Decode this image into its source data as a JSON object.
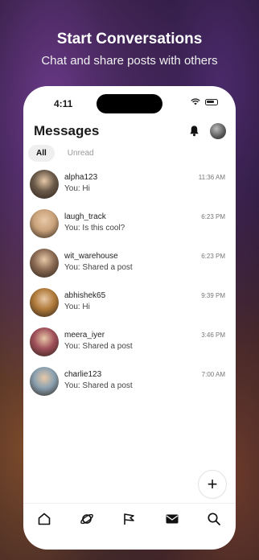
{
  "hero": {
    "title": "Start Conversations",
    "subtitle": "Chat and share posts with others"
  },
  "status_bar": {
    "time": "4:11"
  },
  "header": {
    "title": "Messages"
  },
  "filters": [
    {
      "label": "All",
      "active": true
    },
    {
      "label": "Unread",
      "active": false
    }
  ],
  "conversations": [
    {
      "name": "alpha123",
      "preview": "You: Hi",
      "time": "11:36 AM",
      "avatar_color": "#6b5a4a"
    },
    {
      "name": "laugh_track",
      "preview": "You: Is this cool?",
      "time": "6:23 PM",
      "avatar_color": "#c9a27a"
    },
    {
      "name": "wit_warehouse",
      "preview": "You: Shared a post",
      "time": "6:23 PM",
      "avatar_color": "#8a6a52"
    },
    {
      "name": "abhishek65",
      "preview": "You: Hi",
      "time": "9:39 PM",
      "avatar_color": "#b07a3a"
    },
    {
      "name": "meera_iyer",
      "preview": "You: Shared a post",
      "time": "3:46 PM",
      "avatar_color": "#a0505a"
    },
    {
      "name": "charlie123",
      "preview": "You: Shared a post",
      "time": "7:00 AM",
      "avatar_color": "#8aa0b0"
    }
  ],
  "fab": {
    "label": "+"
  },
  "tabbar": [
    {
      "icon": "home-icon"
    },
    {
      "icon": "planet-icon"
    },
    {
      "icon": "flag-icon"
    },
    {
      "icon": "inbox-icon"
    },
    {
      "icon": "search-icon"
    }
  ]
}
